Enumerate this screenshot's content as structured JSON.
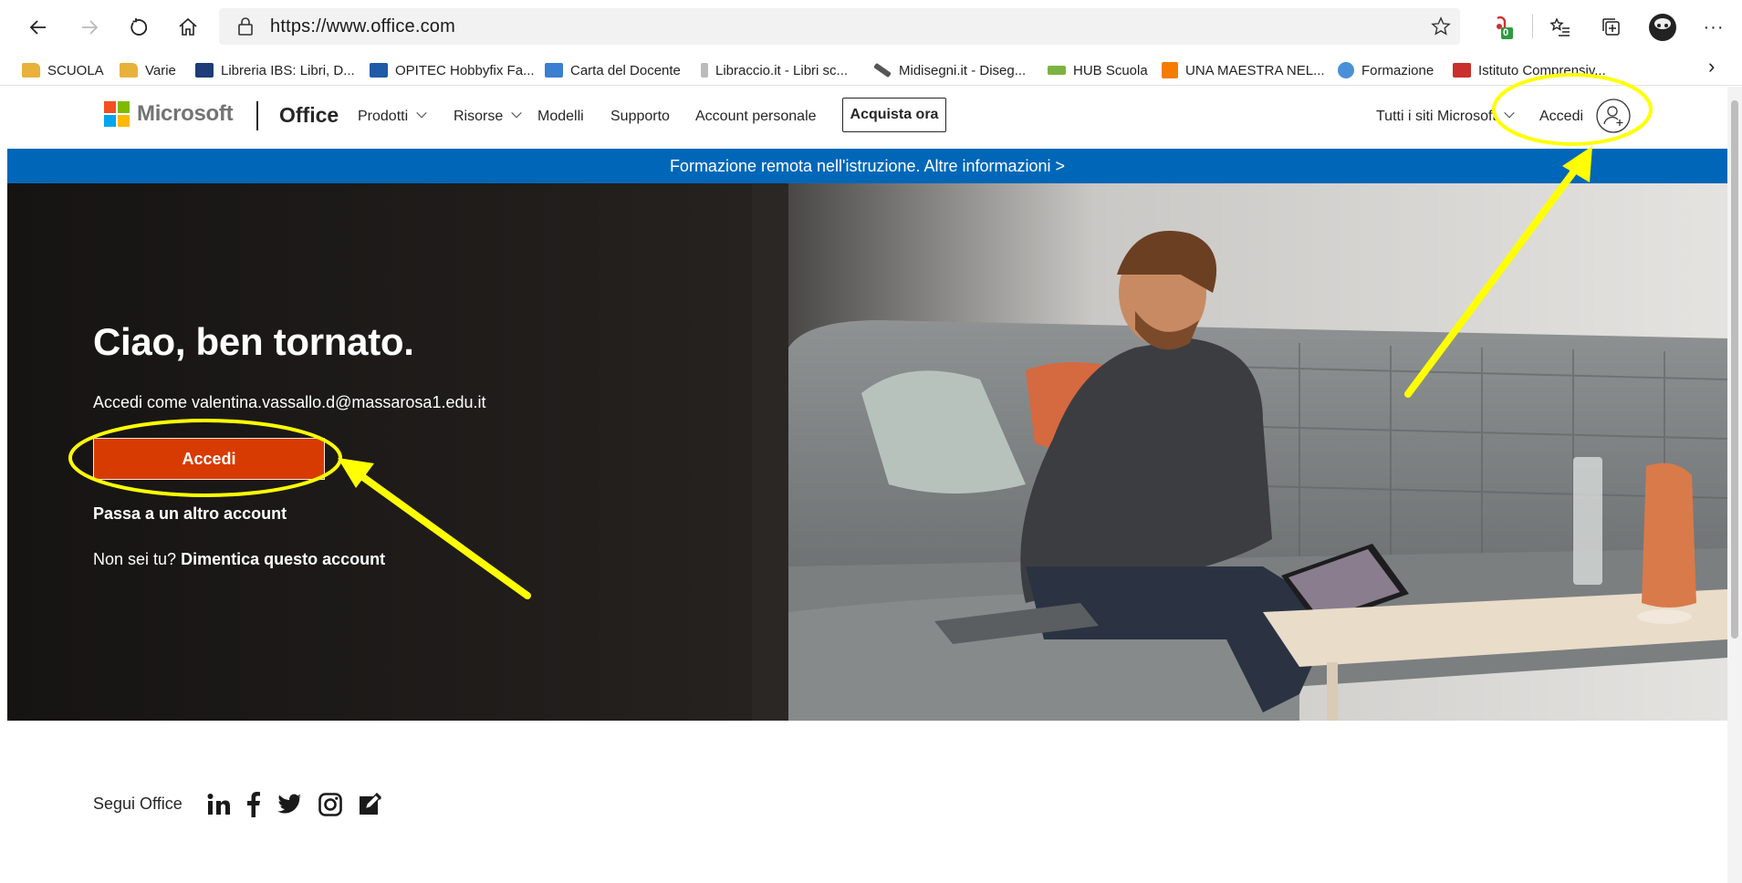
{
  "browser": {
    "url": "https://www.office.com",
    "icons": [
      "back-icon",
      "forward-icon",
      "refresh-icon",
      "home-icon",
      "lock-icon",
      "star-icon",
      "extension-icon",
      "favorites-icon",
      "collections-icon",
      "profile-avatar",
      "more-icon"
    ],
    "extension_badge": "0",
    "more_label": "···"
  },
  "bookmarks": [
    {
      "label": "SCUOLA",
      "icon": "folder-icon",
      "color": "#e8b13b"
    },
    {
      "label": "Varie",
      "icon": "folder-icon",
      "color": "#e8b13b"
    },
    {
      "label": "Libreria IBS: Libri, D...",
      "icon": "ibs-icon",
      "color": "#1d3c78"
    },
    {
      "label": "OPITEC Hobbyfix Fa...",
      "icon": "opitec-icon",
      "color": "#1f5aa6"
    },
    {
      "label": "Carta del Docente",
      "icon": "card-icon",
      "color": "#3b7fd1"
    },
    {
      "label": "Libraccio.it - Libri sc...",
      "icon": "libraccio-icon",
      "color": "#bbbbbb"
    },
    {
      "label": "Midisegni.it - Diseg...",
      "icon": "pencil-icon",
      "color": "#555555"
    },
    {
      "label": "HUB Scuola",
      "icon": "hub-icon",
      "color": "#7bb342"
    },
    {
      "label": "UNA MAESTRA NEL...",
      "icon": "blogger-icon",
      "color": "#f57c00"
    },
    {
      "label": "Formazione",
      "icon": "formazione-icon",
      "color": "#4a90d9"
    },
    {
      "label": "Istituto Comprensiv...",
      "icon": "school-icon",
      "color": "#c9302c"
    }
  ],
  "bookmarks_overflow": "›",
  "office_header": {
    "brand": "Microsoft",
    "brand_colors": [
      "#f25022",
      "#7fba00",
      "#00a4ef",
      "#ffb900"
    ],
    "product": "Office",
    "menu": {
      "prodotti": "Prodotti",
      "risorse": "Risorse",
      "modelli": "Modelli",
      "supporto": "Supporto",
      "account": "Account personale"
    },
    "buy": "Acquista ora",
    "all_sites": "Tutti i siti Microsoft",
    "sign_in": "Accedi"
  },
  "banner": {
    "text": "Formazione remota nell'istruzione. Altre informazioni >",
    "color": "#0067b8"
  },
  "hero": {
    "greeting": "Ciao, ben tornato.",
    "signin_as": "Accedi come valentina.vassallo.d@massarosa1.edu.it",
    "signin_button": "Accedi",
    "signin_button_color": "#d83b01",
    "switch_account": "Passa a un altro account",
    "not_you": "Non sei tu?",
    "forget": "Dimentica questo account"
  },
  "footer": {
    "follow": "Segui Office",
    "social": [
      "linkedin-icon",
      "facebook-icon",
      "twitter-icon",
      "instagram-icon",
      "blog-icon"
    ]
  },
  "annotation_color": "#ffff00"
}
